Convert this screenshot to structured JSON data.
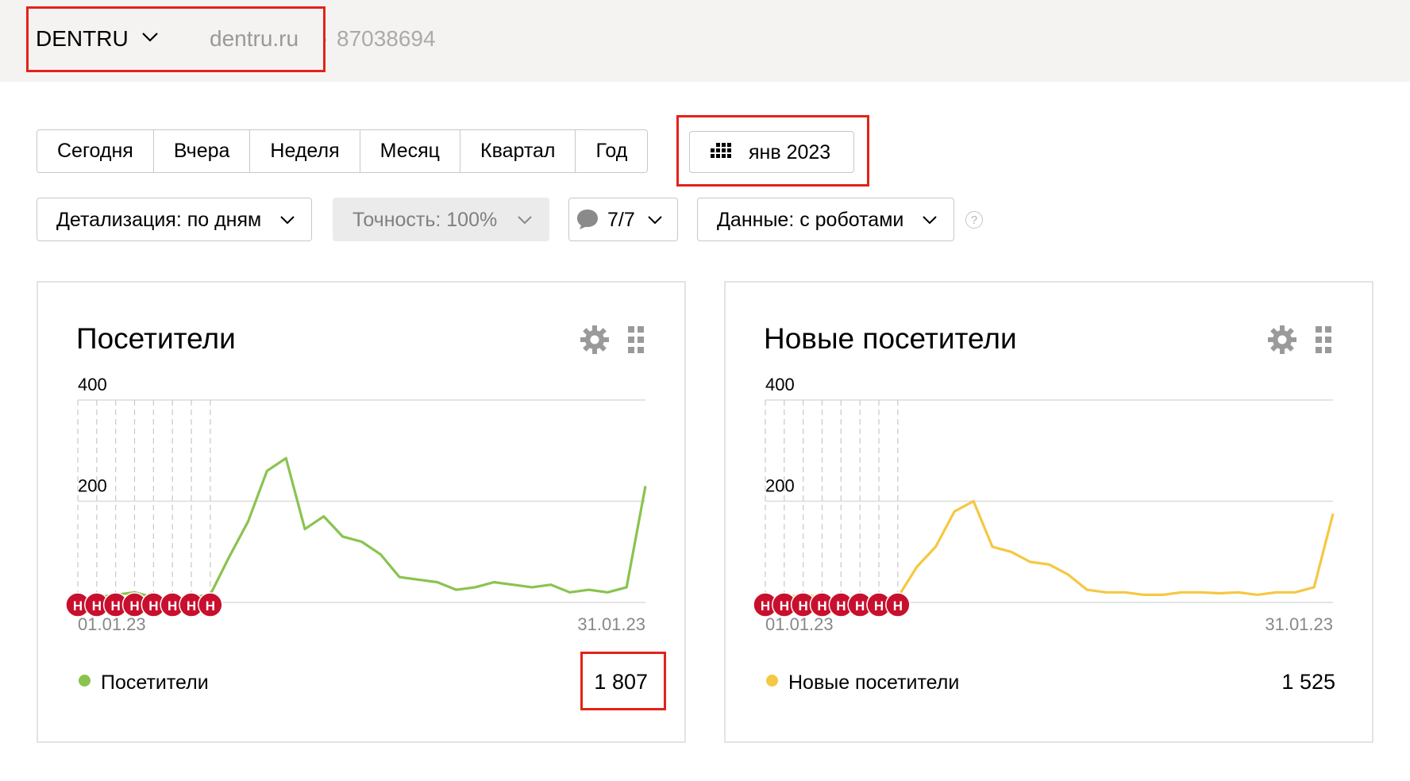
{
  "site": {
    "name": "DENTRU",
    "domain": "dentru.ru",
    "separator": "·",
    "counter_id": "87038694"
  },
  "periods": [
    "Сегодня",
    "Вчера",
    "Неделя",
    "Месяц",
    "Квартал",
    "Год"
  ],
  "date_picker": {
    "label": "янв 2023",
    "icon": "calendar-icon"
  },
  "filters": {
    "detail": "Детализация: по дням",
    "accuracy": "Точность: 100%",
    "goals": "7/7",
    "data": "Данные: с роботами",
    "help": "?"
  },
  "accent": {
    "red": "#e2231a",
    "green": "#8ac34f",
    "yellow": "#f5c842",
    "annotation": "#c8102e"
  },
  "widgets": [
    {
      "title": "Посетители",
      "legend_label": "Посетители",
      "total": "1 807",
      "color": "#8ac34f",
      "annotation_label": "Н"
    },
    {
      "title": "Новые посетители",
      "legend_label": "Новые посетители",
      "total": "1 525",
      "color": "#f5c842",
      "annotation_label": "Н"
    }
  ],
  "chart_data": [
    {
      "type": "line",
      "title": "Посетители",
      "x_start_label": "01.01.23",
      "x_end_label": "31.01.23",
      "y_ticks": [
        "200",
        "400"
      ],
      "ylim": [
        0,
        400
      ],
      "grid": true,
      "legend": "bottom-left",
      "holiday_days": [
        1,
        2,
        3,
        4,
        5,
        6,
        7,
        8
      ],
      "series": [
        {
          "name": "Посетители",
          "color": "#8ac34f",
          "x": [
            1,
            2,
            3,
            4,
            5,
            6,
            7,
            8,
            9,
            10,
            11,
            12,
            13,
            14,
            15,
            16,
            17,
            18,
            19,
            20,
            21,
            22,
            23,
            24,
            25,
            26,
            27,
            28,
            29,
            30,
            31
          ],
          "values": [
            5,
            10,
            15,
            20,
            10,
            5,
            10,
            15,
            90,
            160,
            260,
            285,
            145,
            170,
            130,
            120,
            95,
            50,
            45,
            40,
            25,
            30,
            40,
            35,
            30,
            35,
            20,
            25,
            20,
            30,
            230
          ]
        }
      ]
    },
    {
      "type": "line",
      "title": "Новые посетители",
      "x_start_label": "01.01.23",
      "x_end_label": "31.01.23",
      "y_ticks": [
        "200",
        "400"
      ],
      "ylim": [
        0,
        400
      ],
      "grid": true,
      "legend": "bottom-left",
      "holiday_days": [
        1,
        2,
        3,
        4,
        5,
        6,
        7,
        8
      ],
      "series": [
        {
          "name": "Новые посетители",
          "color": "#f5c842",
          "x": [
            1,
            2,
            3,
            4,
            5,
            6,
            7,
            8,
            9,
            10,
            11,
            12,
            13,
            14,
            15,
            16,
            17,
            18,
            19,
            20,
            21,
            22,
            23,
            24,
            25,
            26,
            27,
            28,
            29,
            30,
            31
          ],
          "values": [
            5,
            10,
            15,
            10,
            5,
            5,
            10,
            10,
            70,
            110,
            180,
            200,
            110,
            100,
            80,
            75,
            55,
            25,
            20,
            20,
            15,
            15,
            20,
            20,
            18,
            20,
            15,
            20,
            20,
            30,
            175
          ]
        }
      ]
    }
  ]
}
